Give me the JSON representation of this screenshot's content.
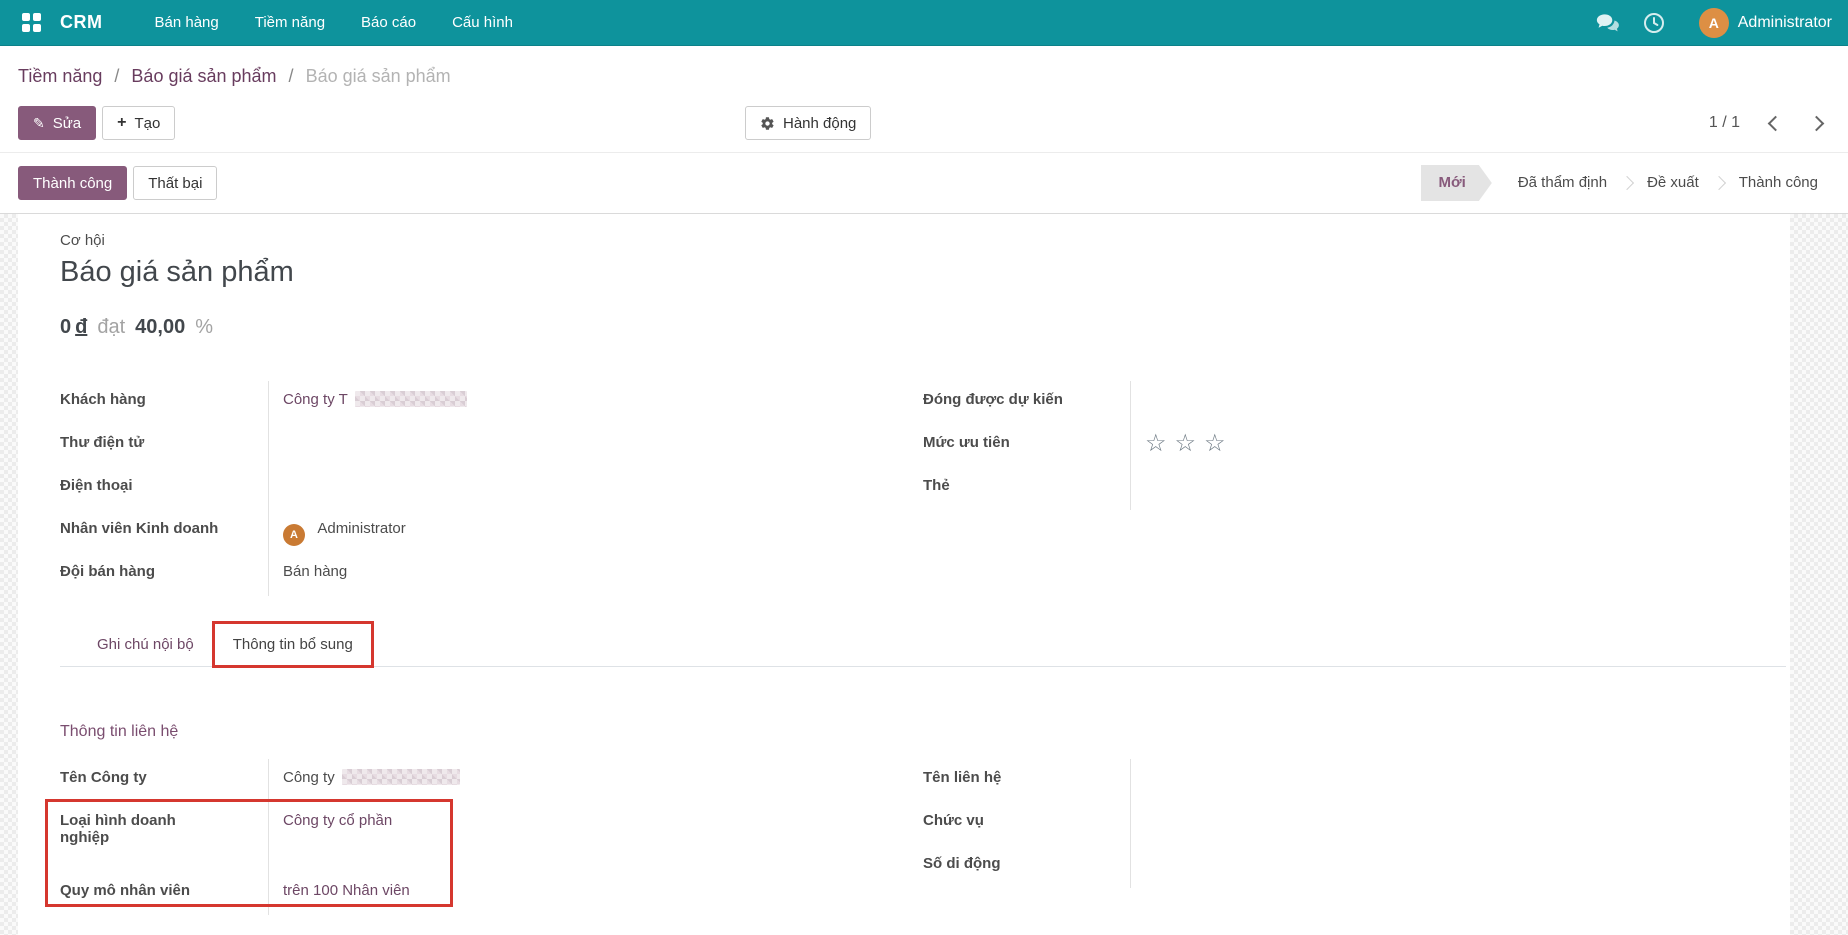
{
  "navbar": {
    "app_name": "CRM",
    "menus": [
      "Bán hàng",
      "Tiềm năng",
      "Báo cáo",
      "Cấu hình"
    ],
    "user_name": "Administrator",
    "avatar_letter": "A"
  },
  "breadcrumb": {
    "links": [
      "Tiềm năng",
      "Báo giá sản phẩm"
    ],
    "separator": "/",
    "current": "Báo giá sản phẩm"
  },
  "control_panel": {
    "edit_label": "Sửa",
    "create_label": "Tạo",
    "action_label": "Hành động",
    "pager_text": "1 / 1"
  },
  "statusbar": {
    "won_label": "Thành công",
    "lost_label": "Thất bại",
    "stages": [
      {
        "label": "Mới",
        "active": true
      },
      {
        "label": "Đã thẩm định",
        "active": false
      },
      {
        "label": "Đề xuất",
        "active": false
      },
      {
        "label": "Thành công",
        "active": false
      }
    ]
  },
  "sheet": {
    "type_label": "Cơ hội",
    "title": "Báo giá sản phẩm",
    "revenue": {
      "amount": "0",
      "currency": "đ",
      "join_word": "đạt",
      "probability": "40,00",
      "percent_sign": "%"
    },
    "fields": {
      "customer": {
        "label": "Khách hàng",
        "value": "Công ty T",
        "redacted": true
      },
      "email": {
        "label": "Thư điện tử",
        "value": ""
      },
      "phone": {
        "label": "Điện thoại",
        "value": ""
      },
      "salesperson": {
        "label": "Nhân viên Kinh doanh",
        "value": "Administrator",
        "avatar_letter": "A"
      },
      "sales_team": {
        "label": "Đội bán hàng",
        "value": "Bán hàng"
      },
      "expected_closing": {
        "label": "Đóng được dự kiến",
        "value": ""
      },
      "priority": {
        "label": "Mức ưu tiên",
        "stars": 3,
        "star_glyph": "☆"
      },
      "tags": {
        "label": "Thẻ",
        "value": ""
      }
    },
    "tabs": {
      "internal_notes": "Ghi chú nội bộ",
      "extra_info": "Thông tin bổ sung"
    },
    "contact_info": {
      "heading": "Thông tin liên hệ",
      "company_name": {
        "label": "Tên Công ty",
        "value": "Công ty",
        "redacted": true
      },
      "company_type": {
        "label": "Loại hình doanh nghiệp",
        "value": "Công ty cổ phần"
      },
      "company_size": {
        "label": "Quy mô nhân viên",
        "value": "trên 100 Nhân viên"
      },
      "contact_name": {
        "label": "Tên liên hệ",
        "value": ""
      },
      "job_position": {
        "label": "Chức vụ",
        "value": ""
      },
      "mobile": {
        "label": "Số di động",
        "value": ""
      }
    }
  },
  "colors": {
    "navbar_teal": "#0e939c",
    "primary_purple": "#875A7B",
    "link_purple": "#6d4765",
    "annotation_red": "#d5372f",
    "avatar_orange": "#dd8f44",
    "stage_active_bg": "#e4e4e4"
  }
}
